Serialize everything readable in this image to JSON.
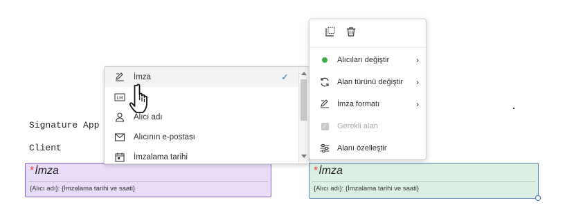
{
  "document": {
    "line1": "Signature App",
    "line2": "Client"
  },
  "fields": [
    {
      "required_mark": "*",
      "title": "İmza",
      "subtitle": "{Alıcı adı}: {İmzalama tarihi ve saati}",
      "color": "#e8dcf8"
    },
    {
      "required_mark": "*",
      "title": "İmza",
      "subtitle": "{Alıcı adı}: {İmzalama tarihi ve saati}",
      "color": "#dcefe4"
    }
  ],
  "dropdown": {
    "items": [
      {
        "label": "İmza",
        "icon": "signature-pen-icon",
        "selected": true
      },
      {
        "label": "",
        "icon": "initials-icon",
        "selected": false
      },
      {
        "label": "Alıcı adı",
        "icon": "person-icon",
        "selected": false
      },
      {
        "label": "Alıcının e-postası",
        "icon": "envelope-icon",
        "selected": false
      },
      {
        "label": "İmzalama tarihi",
        "icon": "calendar-icon",
        "selected": false
      }
    ],
    "check_glyph": "✓",
    "check_color": "#2b76c6"
  },
  "context_menu": {
    "items": [
      {
        "label": "Alıcıları değiştir",
        "icon": "green-dot-icon",
        "has_submenu": true,
        "disabled": false
      },
      {
        "label": "Alan türünü değiştir",
        "icon": "refresh-icon",
        "has_submenu": true,
        "disabled": false
      },
      {
        "label": "İmza formatı",
        "icon": "signature-pen-icon",
        "has_submenu": true,
        "disabled": false
      },
      {
        "label": "Gerekli alan",
        "icon": "checkbox-icon",
        "has_submenu": false,
        "disabled": true
      },
      {
        "label": "Alanı özelleştir",
        "icon": "sliders-icon",
        "has_submenu": false,
        "disabled": false
      }
    ],
    "chevron": "›",
    "accent_green": "#3fae4a"
  }
}
